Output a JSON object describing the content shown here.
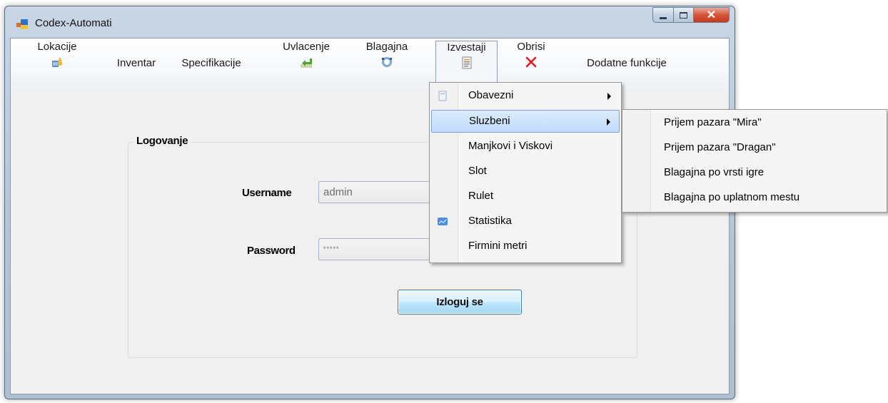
{
  "window": {
    "title": "Codex-Automati"
  },
  "menu": {
    "lokacije": "Lokacije",
    "inventar": "Inventar",
    "specifikacije": "Specifikacije",
    "uvlacenje": "Uvlacenje",
    "blagajna": "Blagajna",
    "izvestaji": "Izvestaji",
    "obrisi": "Obrisi",
    "dodatne": "Dodatne funkcije"
  },
  "login": {
    "group_title": "Logovanje",
    "username_label": "Username",
    "username_value": "admin",
    "password_label": "Password",
    "password_value": "*****",
    "logout_button": "Izloguj se"
  },
  "izvestaji_menu": {
    "items": [
      "Obavezni",
      "Sluzbeni",
      "Manjkovi i Viskovi",
      "Slot",
      "Rulet",
      "Statistika",
      "Firmini metri"
    ]
  },
  "sluzbeni_submenu": {
    "items": [
      "Prijem pazara \"Mira\"",
      "Prijem pazara \"Dragan\"",
      "Blagajna po vrsti igre",
      "Blagajna po uplatnom mestu"
    ]
  },
  "colors": {
    "accent": "#3c7fb1",
    "close": "#c7381d",
    "highlight": "#c1dcfc"
  }
}
